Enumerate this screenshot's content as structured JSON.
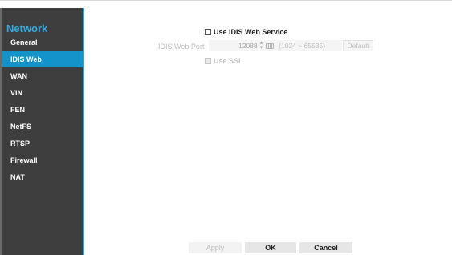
{
  "sidebar": {
    "title": "Network",
    "items": [
      {
        "label": "General",
        "active": false
      },
      {
        "label": "IDIS Web",
        "active": true
      },
      {
        "label": "WAN",
        "active": false
      },
      {
        "label": "VIN",
        "active": false
      },
      {
        "label": "FEN",
        "active": false
      },
      {
        "label": "NetFS",
        "active": false
      },
      {
        "label": "RTSP",
        "active": false
      },
      {
        "label": "Firewall",
        "active": false
      },
      {
        "label": "NAT",
        "active": false
      }
    ]
  },
  "settings": {
    "use_web_service_label": "Use IDIS Web Service",
    "use_web_service_checked": false,
    "port_label": "IDIS Web Port",
    "port_value": "12088",
    "port_range": "(1024 ~ 65535)",
    "default_label": "Default",
    "use_ssl_label": "Use SSL",
    "use_ssl_checked": false
  },
  "footer": {
    "apply_label": "Apply",
    "ok_label": "OK",
    "cancel_label": "Cancel"
  },
  "colors": {
    "accent": "#2aa5dc",
    "sidebar_bg": "#3e3e3e",
    "active_item_bg": "#1393c9"
  },
  "icons": {
    "stepper": "up-down-stepper-icon",
    "keyboard": "keyboard-icon"
  }
}
